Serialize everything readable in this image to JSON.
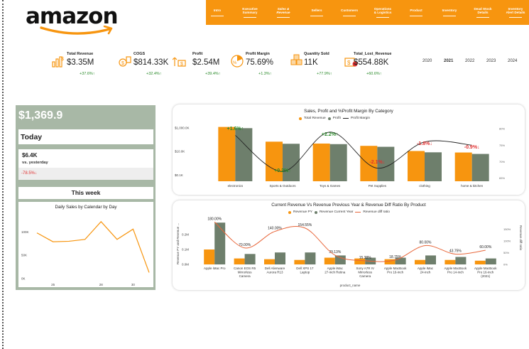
{
  "logo": {
    "text": "amazon"
  },
  "nav": {
    "items": [
      {
        "label": "Intro"
      },
      {
        "label": "Executive\nSummary"
      },
      {
        "label": "Sales &\nRevenue"
      },
      {
        "label": "Sellers"
      },
      {
        "label": "Customers"
      },
      {
        "label": "Operations\n& Logistics"
      },
      {
        "label": "Product"
      },
      {
        "label": "Inventory"
      },
      {
        "label": "Dead Stock\nDetails"
      },
      {
        "label": "Inventory\nAlert Details"
      }
    ]
  },
  "kpis": [
    {
      "label": "Total Revenue",
      "value": "$3.35M",
      "change": "+37.6%↑",
      "icon": "revenue-icon"
    },
    {
      "label": "COGS",
      "value": "$814.33K",
      "change": "+32.4%↑",
      "icon": "cogs-icon"
    },
    {
      "label": "Profit",
      "value": "$2.54M",
      "change": "+39.4%↑",
      "icon": "profit-icon"
    },
    {
      "label": "Profit Margin",
      "value": "75.69%",
      "change": "+1.3%↑",
      "icon": "margin-icon"
    },
    {
      "label": "Quantity Sold",
      "value": "11K",
      "change": "+77.9%↑",
      "icon": "boxes-icon"
    },
    {
      "label": "Total_Lost_Revenue",
      "value": "$554.88K",
      "change": "+60.6%↑",
      "icon": "lost-revenue-icon"
    }
  ],
  "years": [
    "2020",
    "2021",
    "2022",
    "2023",
    "2024"
  ],
  "selected_year": "2021",
  "colors": {
    "orange": "#f7950f",
    "green": "#6e7f6c",
    "panel": "#a8b8a6",
    "up": "#2a8a2a",
    "down": "#e03030"
  },
  "left": {
    "big_value": "$1,369.9",
    "today_label": "Today",
    "yesterday_value": "$6.4K",
    "yesterday_label": "vs. yesterday",
    "yesterday_change": "-78.5%↓",
    "week_label": "This week"
  },
  "chart_data": [
    {
      "type": "bar",
      "title": "Sales, Profit and %Profit Margin By Category",
      "categories": [
        "electronics",
        "Sports & Outdoors",
        "Toys & Games",
        "Pet Supplies",
        "clothing",
        "home & kitchen"
      ],
      "series": [
        {
          "name": "Total Revenue",
          "values": [
            1200000,
            68000,
            47000,
            30000,
            11000,
            8200
          ]
        },
        {
          "name": "Profit",
          "values": [
            950000,
            45000,
            42000,
            25000,
            8500,
            6200
          ]
        },
        {
          "name": "Profit Margin",
          "values": [
            78,
            67,
            79,
            68,
            76,
            75
          ]
        }
      ],
      "data_labels": [
        "+1.6%↑",
        "+0.2%↑",
        "+2.2%↑",
        "-2.1%↓",
        "-1.8%↓",
        "-0.9%↓"
      ],
      "y_ticks": [
        "$1,000.0K",
        "$10.0K",
        "$0.1K"
      ],
      "y2_ticks": [
        "80%",
        "75%",
        "70%",
        "65%"
      ],
      "yscale": "log"
    },
    {
      "type": "bar",
      "title": "Current Revenue Vs Revenue Previous Year & Revenue Diff Ratio By Product",
      "categories": [
        "Apple iMac Pro",
        "Canon EOS R5 Mirrorless Camera",
        "Dell Alienware Aurora R13",
        "Dell XPS 17 Laptop",
        "Apple iMac 27-inch Retina",
        "Sony A7R IV Mirrorless Camera",
        "Apple MacBook Pro 16-inch",
        "Apple iMac 24-inch",
        "Apple MacBook Pro 14-inch",
        "Apple MacBook Pro 16-inch (2021)"
      ],
      "series": [
        {
          "name": "Revenue PY",
          "values": [
            0.1,
            0.04,
            0.035,
            0.03,
            0.045,
            0.04,
            0.035,
            0.03,
            0.03,
            0.025
          ]
        },
        {
          "name": "Revenue Current Year",
          "values": [
            0.28,
            0.07,
            0.08,
            0.08,
            0.06,
            0.045,
            0.045,
            0.06,
            0.05,
            0.04
          ]
        },
        {
          "name": "Revenue diff ratio",
          "values": [
            180.0,
            70.0,
            140.0,
            154.55,
            39.13,
            15.38,
            18.75,
            80.0,
            43.75,
            60.0
          ]
        }
      ],
      "data_labels": [
        "180.00%",
        "70.00%",
        "140.00%",
        "154.55%",
        "39.13%",
        "15.38%",
        "18.75%",
        "80.00%",
        "43.75%",
        "60.00%"
      ],
      "y_ticks": [
        "0.2M",
        "0.1M",
        "0.0M"
      ],
      "y2_ticks": [
        "150%",
        "100%",
        "50%",
        "0%"
      ],
      "ylabel": "Revenue PY and Revenue ...",
      "y2label": "Revenue diff ratio",
      "xlabel": "product_name"
    },
    {
      "type": "line",
      "title": "Daily Sales by Calendar by Day",
      "x": [
        24,
        25,
        26,
        27,
        28,
        29,
        30,
        31
      ],
      "y": [
        98000,
        79000,
        80000,
        84000,
        122000,
        84000,
        106000,
        13000
      ],
      "x_ticks": [
        "25",
        "28",
        "30"
      ],
      "y_ticks": [
        "100K",
        "50K",
        "0K"
      ]
    }
  ]
}
